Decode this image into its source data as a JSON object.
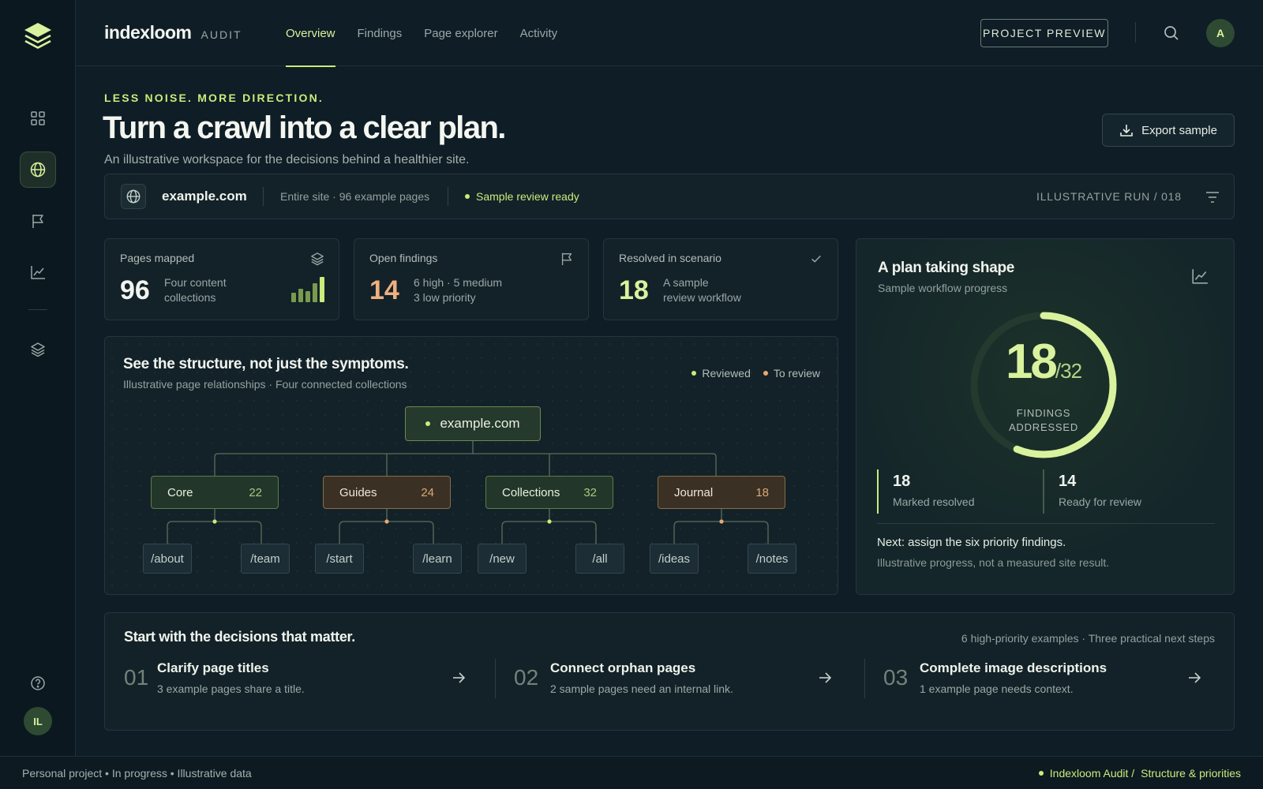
{
  "brand": {
    "name": "indexloom",
    "sub": "AUDIT"
  },
  "nav": {
    "tabs": [
      {
        "label": "Overview",
        "active": true
      },
      {
        "label": "Findings"
      },
      {
        "label": "Page explorer"
      },
      {
        "label": "Activity"
      }
    ],
    "preview_label": "PROJECT PREVIEW",
    "avatar": "A"
  },
  "rail": {
    "icons": [
      "layers-logo-icon",
      "grid-icon",
      "globe-icon",
      "flag-icon",
      "chart-icon",
      "layers-icon",
      "help-icon"
    ],
    "avatar": "IL"
  },
  "header": {
    "eyebrow": "LESS NOISE. MORE DIRECTION.",
    "title": "Turn a crawl into a clear plan.",
    "subtitle": "An illustrative workspace for the decisions behind a healthier site.",
    "export_label": "Export sample"
  },
  "site": {
    "domain": "example.com",
    "scope": "Entire site · 96 example pages",
    "status": "Sample review ready",
    "run": "ILLUSTRATIVE RUN / 018"
  },
  "stats": [
    {
      "label": "Pages mapped",
      "value": "96",
      "desc1": "Four content",
      "desc2": "collections",
      "icon": "layers-icon"
    },
    {
      "label": "Open findings",
      "value": "14",
      "desc1": "6 high · 5 medium",
      "desc2": "3 low priority",
      "icon": "flag-icon"
    },
    {
      "label": "Resolved in scenario",
      "value": "18",
      "desc1": "A sample",
      "desc2": "review workflow",
      "icon": "check-icon"
    }
  ],
  "structure": {
    "title": "See the structure, not just the symptoms.",
    "subtitle": "Illustrative page relationships · Four connected collections",
    "legend": [
      {
        "label": "Reviewed",
        "color": "#c9ec7a"
      },
      {
        "label": "To review",
        "color": "#e9a873"
      }
    ],
    "root": "example.com",
    "collections": [
      {
        "name": "Core",
        "count": "22",
        "status": "reviewed",
        "pages": [
          "/about",
          "/team"
        ]
      },
      {
        "name": "Guides",
        "count": "24",
        "status": "to-review",
        "pages": [
          "/start",
          "/learn"
        ]
      },
      {
        "name": "Collections",
        "count": "32",
        "status": "reviewed",
        "pages": [
          "/new",
          "/all"
        ]
      },
      {
        "name": "Journal",
        "count": "18",
        "status": "to-review",
        "pages": [
          "/ideas",
          "/notes"
        ]
      }
    ]
  },
  "plan": {
    "title": "A plan taking shape",
    "subtitle": "Sample workflow progress",
    "addressed": "18",
    "total": "/32",
    "progress": 0.5625,
    "gauge_label_1": "FINDINGS",
    "gauge_label_2": "ADDRESSED",
    "resolved_value": "18",
    "resolved_label": "Marked resolved",
    "review_value": "14",
    "review_label": "Ready for review",
    "next": "Next: assign the six priority findings.",
    "note": "Illustrative progress, not a measured site result."
  },
  "steps": {
    "title": "Start with the decisions that matter.",
    "meta": "6 high-priority examples · Three practical next steps",
    "items": [
      {
        "num": "01",
        "title": "Clarify page titles",
        "desc": "3 example pages share a title."
      },
      {
        "num": "02",
        "title": "Connect orphan pages",
        "desc": "2 sample pages need an internal link."
      },
      {
        "num": "03",
        "title": "Complete image descriptions",
        "desc": "1 example page needs context."
      }
    ]
  },
  "footer": {
    "left": "Personal project • In progress • Illustrative data",
    "crumb1": "Indexloom Audit /",
    "crumb2": "Structure & priorities"
  },
  "colors": {
    "accent": "#c9ec7a",
    "warning": "#e9a873",
    "background": "#0f1d26",
    "card": "#132229"
  }
}
